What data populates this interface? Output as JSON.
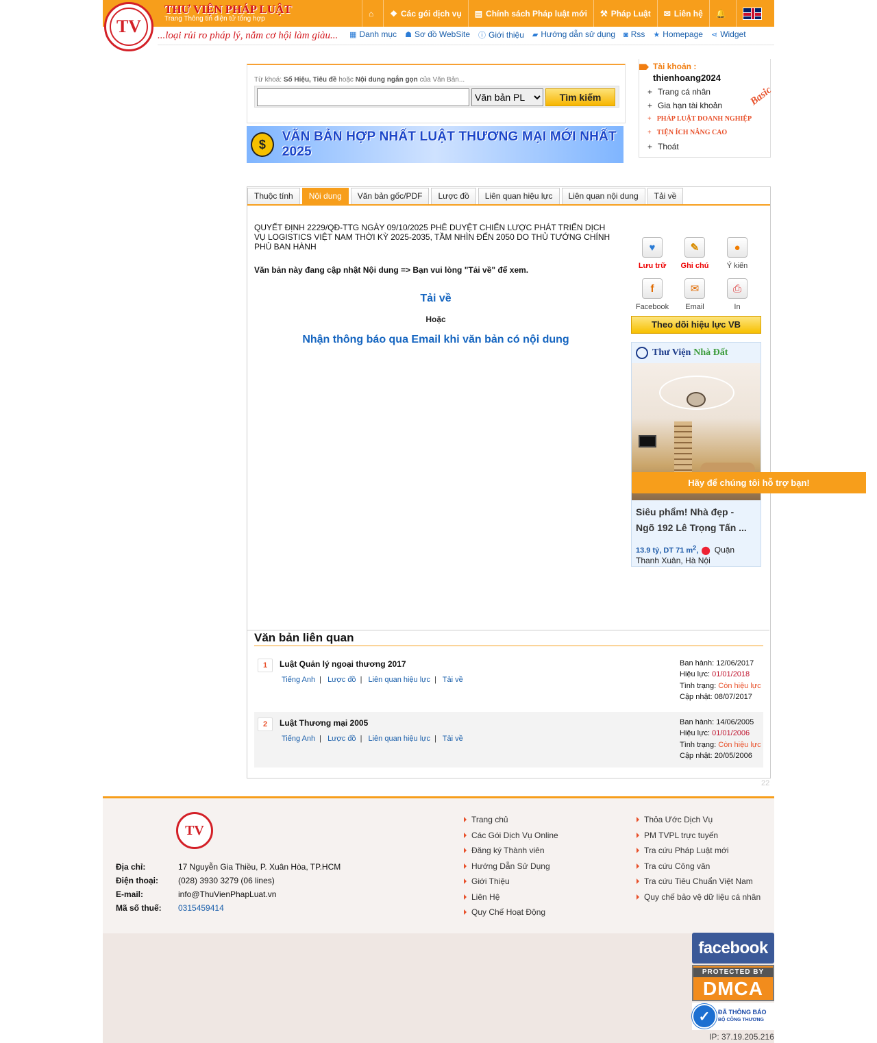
{
  "header": {
    "site_title": "THƯ VIỆN PHÁP LUẬT",
    "site_sub": "Trang Thông tin điện tử tổng hợp",
    "slogan": "...loại rủi ro pháp lý, nắm cơ hội làm giàu...",
    "topnav": [
      {
        "label": "",
        "icon": "home-icon"
      },
      {
        "label": "Các gói dịch vụ",
        "icon": "dropbox-icon"
      },
      {
        "label": "Chính sách Pháp luật mới",
        "icon": "newspaper-icon"
      },
      {
        "label": "Pháp Luật",
        "icon": "gavel-icon"
      },
      {
        "label": "Liên hệ",
        "icon": "envelope-icon"
      },
      {
        "label": "",
        "icon": "bell-icon"
      }
    ],
    "subnav": [
      {
        "label": "Danh mục",
        "icon": "list-icon"
      },
      {
        "label": "Sơ đồ WebSite",
        "icon": "sitemap-icon"
      },
      {
        "label": "Giới thiệu",
        "icon": "info-icon"
      },
      {
        "label": "Hướng dẫn sử dụng",
        "icon": "book-icon"
      },
      {
        "label": "Rss",
        "icon": "rss-icon"
      },
      {
        "label": "Homepage",
        "icon": "star-icon"
      },
      {
        "label": "Widget",
        "icon": "share-icon"
      }
    ]
  },
  "search": {
    "label_prefix": "Từ khoá:",
    "label_b1": "Số Hiệu, Tiêu đề",
    "label_mid": "hoặc",
    "label_b2": "Nội dung ngắn gọn",
    "label_suffix": "của Văn Bản...",
    "input_value": "",
    "select_value": "Văn bản PL",
    "button": "Tìm kiếm"
  },
  "banner": {
    "text": "VĂN BẢN HỢP NHẤT LUẬT THƯƠNG MẠI MỚI NHẤT 2025"
  },
  "account": {
    "title": "Tài khoản :",
    "username": "thienhoang2024",
    "items": [
      "Trang cá nhân",
      "Gia hạn tài khoản",
      "PHÁP LUẬT DOANH NGHIỆP",
      "TIỆN ÍCH NÂNG CAO",
      "Thoát"
    ],
    "badge": "Basic"
  },
  "tabs": [
    "Thuộc tính",
    "Nội dung",
    "Văn bản gốc/PDF",
    "Lược đồ",
    "Liên quan hiệu lực",
    "Liên quan nội dung",
    "Tải về"
  ],
  "document": {
    "title": "QUYẾT ĐỊNH 2229/QĐ-TTG NGÀY 09/10/2025 PHÊ DUYỆT CHIẾN LƯỢC PHÁT TRIỂN DỊCH VỤ LOGISTICS VIỆT NAM THỜI KỲ 2025-2035, TẦM NHÌN ĐẾN 2050 DO THỦ TƯỚNG CHÍNH PHỦ BAN HÀNH",
    "note": "Văn bản này đang cập nhật Nội dung => Bạn vui lòng \"Tải về\" để xem.",
    "download": "Tải về",
    "or": "Hoặc",
    "notify": "Nhận thông báo qua Email khi văn bản có nội dung"
  },
  "tools": [
    {
      "label": "Lưu trữ",
      "icon": "heart-plus-icon"
    },
    {
      "label": "Ghi chú",
      "icon": "note-icon"
    },
    {
      "label": "Ý kiến",
      "icon": "comment-icon"
    },
    {
      "label": "Facebook",
      "icon": "facebook-icon"
    },
    {
      "label": "Email",
      "icon": "email-icon"
    },
    {
      "label": "In",
      "icon": "print-icon"
    }
  ],
  "follow_button": "Theo dõi hiệu lực VB",
  "ad": {
    "brand_a": "Thư Viện",
    "brand_b": "Nhà Đất",
    "title_line1": "Siêu phẩm! Nhà đẹp -",
    "title_line2": "Ngõ 192 Lê Trọng Tấn ...",
    "price": "13.9 tỷ, DT 71 m",
    "sup": "2",
    "location": "Quận Thanh Xuân, Hà Nội"
  },
  "support": "Hãy để chúng tôi hỗ trợ bạn!",
  "related": {
    "heading": "Văn bản liên quan",
    "items": [
      {
        "num": "1",
        "name": "Luật Quản lý ngoại thương 2017",
        "links": [
          "Tiếng Anh",
          "Lược đồ",
          "Liên quan hiệu lực",
          "Tải về"
        ],
        "ban_hanh_k": "Ban hành:",
        "ban_hanh": "12/06/2017",
        "hieu_luc_k": "Hiệu lực:",
        "hieu_luc": "01/01/2018",
        "tinh_trang_k": "Tình trạng:",
        "tinh_trang": "Còn hiệu lực",
        "cap_nhat_k": "Cập nhật:",
        "cap_nhat": "08/07/2017"
      },
      {
        "num": "2",
        "name": "Luật Thương mại 2005",
        "links": [
          "Tiếng Anh",
          "Lược đồ",
          "Liên quan hiệu lực",
          "Tải về"
        ],
        "ban_hanh_k": "Ban hành:",
        "ban_hanh": "14/06/2005",
        "hieu_luc_k": "Hiệu lực:",
        "hieu_luc": "01/01/2006",
        "tinh_trang_k": "Tình trạng:",
        "tinh_trang": "Còn hiệu lực",
        "cap_nhat_k": "Cập nhật:",
        "cap_nhat": "20/05/2006"
      }
    ]
  },
  "page_counter": "22",
  "footer": {
    "address_k": "Địa chỉ:",
    "address": "17 Nguyễn Gia Thiều, P. Xuân Hòa, TP.HCM",
    "phone_k": "Điện thoại:",
    "phone": "(028) 3930 3279 (06 lines)",
    "email_k": "E-mail:",
    "email": "info@ThuVienPhapLuat.vn",
    "tax_k": "Mã số thuế:",
    "tax": "0315459414",
    "col1": [
      "Trang chủ",
      "Các Gói Dịch Vụ Online",
      "Đăng ký Thành viên",
      "Hướng Dẫn Sử Dụng",
      "Giới Thiệu",
      "Liên Hệ",
      "Quy Chế Hoạt Động"
    ],
    "col2": [
      "Thỏa Ước Dịch Vụ",
      "PM TVPL trực tuyến",
      "Tra cứu Pháp Luật mới",
      "Tra cứu Công văn",
      "Tra cứu Tiêu Chuẩn Việt Nam",
      "Quy chế bảo vệ dữ liệu cá nhân"
    ]
  },
  "badges": {
    "facebook": "facebook",
    "dmca_top": "PROTECTED BY",
    "dmca": "DMCA",
    "bct_line1": "ĐÃ THÔNG BÁO",
    "bct_line2": "BỘ CÔNG THƯƠNG"
  },
  "ip": "IP: 37.19.205.216"
}
